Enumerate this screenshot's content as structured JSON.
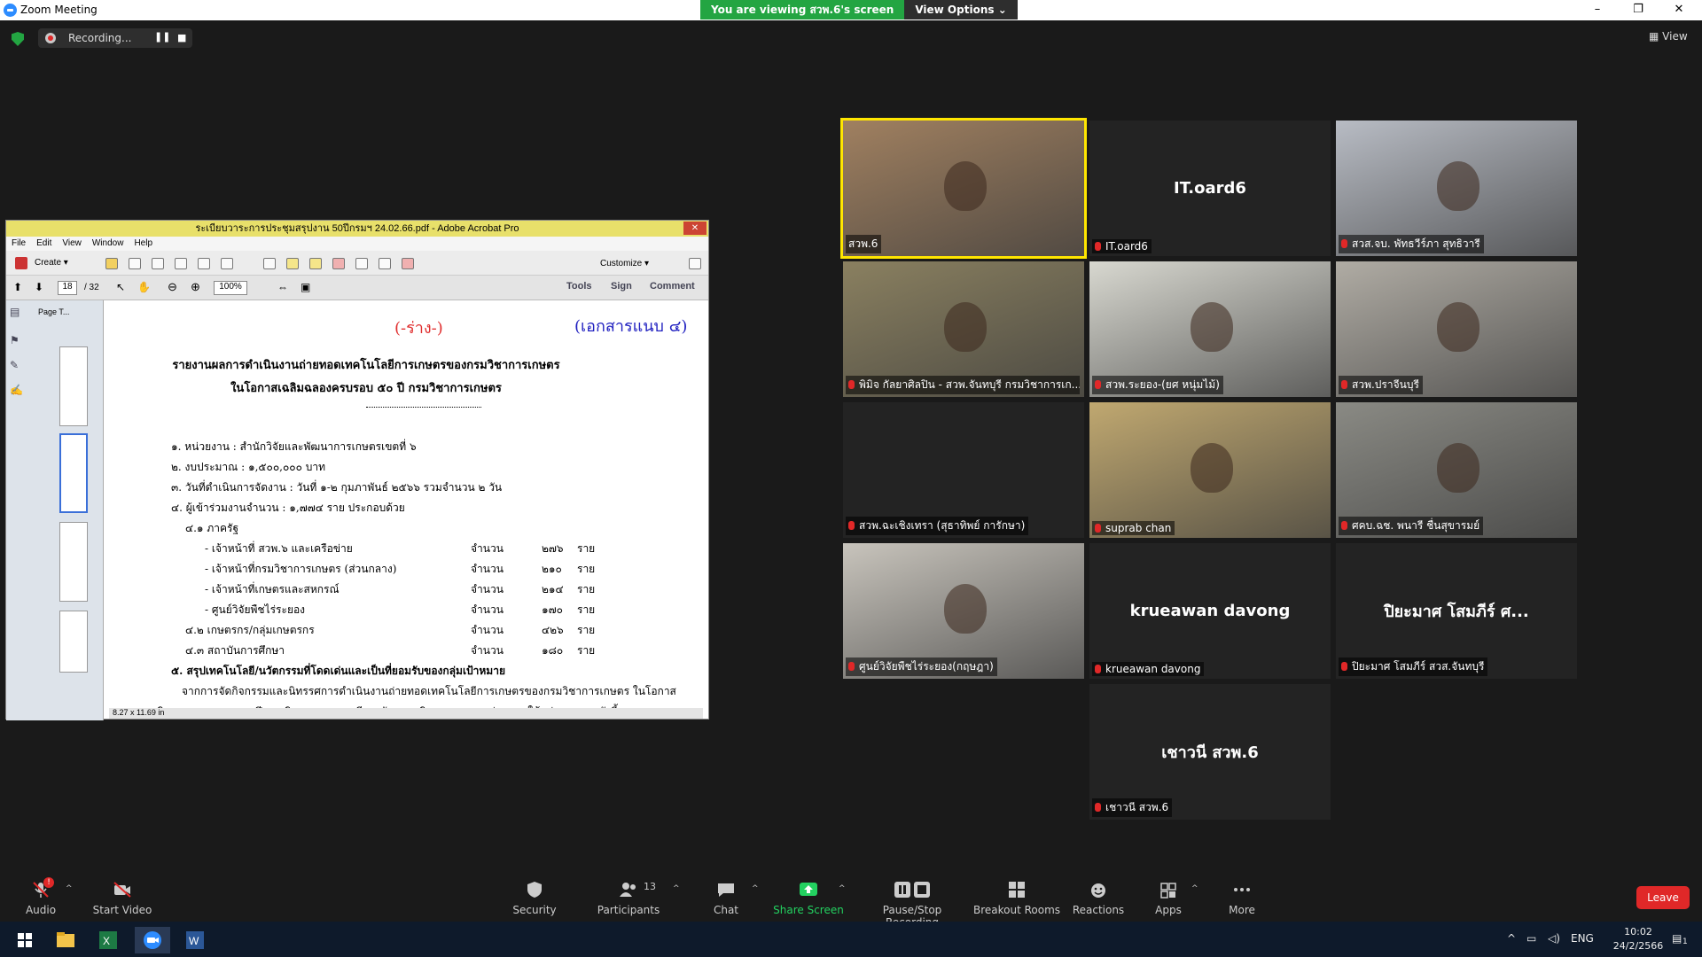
{
  "window": {
    "title": "Zoom Meeting",
    "banner_viewing": "You are viewing สวพ.6's screen",
    "banner_options": "View Options"
  },
  "topbar": {
    "recording_label": "Recording...",
    "view_label": "View"
  },
  "acrobat": {
    "title": "ระเบียบวาระการประชุมสรุปงาน 50ปีกรมฯ 24.02.66.pdf - Adobe Acrobat Pro",
    "menu": [
      "File",
      "Edit",
      "View",
      "Window",
      "Help"
    ],
    "create_label": "Create",
    "customize_label": "Customize",
    "page_current": "18",
    "page_total": "/ 32",
    "zoom": "100%",
    "tab_tools": "Tools",
    "tab_sign": "Sign",
    "tab_comment": "Comment",
    "page_thumbnails_label": "Page T...",
    "page_size": "8.27 x 11.69 in",
    "document": {
      "draft": "(-ร่าง-)",
      "attachment": "(เอกสารแนบ ๔)",
      "heading1": "รายงานผลการดำเนินงานถ่ายทอดเทคโนโลยีการเกษตรของกรมวิชาการเกษตร",
      "heading2": "ในโอกาสเฉลิมฉลองครบรอบ ๕๐ ปี กรมวิชาการเกษตร",
      "lines": [
        "๑. หน่วยงาน : สำนักวิจัยและพัฒนาการเกษตรเขตที่ ๖",
        "๒. งบประมาณ :  ๑,๕๐๐,๐๐๐  บาท",
        "๓. วันที่ดำเนินการจัดงาน : วันที่ ๑-๒ กุมภาพันธ์  ๒๕๖๖ รวมจำนวน ๒ วัน",
        "๔. ผู้เข้าร่วมงานจำนวน : ๑,๗๗๔ ราย ประกอบด้วย",
        "๔.๑ ภาครัฐ"
      ],
      "rows": [
        {
          "label": "- เจ้าหน้าที่ สวพ.๖ และเครือข่าย",
          "unit": "จำนวน",
          "value": "๒๗๖",
          "suffix": "ราย"
        },
        {
          "label": "- เจ้าหน้าที่กรมวิชาการเกษตร (ส่วนกลาง)",
          "unit": "จำนวน",
          "value": "๒๑๐",
          "suffix": "ราย"
        },
        {
          "label": "- เจ้าหน้าที่เกษตรและสหกรณ์",
          "unit": "จำนวน",
          "value": "๒๑๔",
          "suffix": "ราย"
        },
        {
          "label": "- ศูนย์วิจัยพืชไร่ระยอง",
          "unit": "จำนวน",
          "value": "๑๗๐",
          "suffix": "ราย"
        },
        {
          "label": "๔.๒ เกษตรกร/กลุ่มเกษตรกร",
          "unit": "จำนวน",
          "value": "๔๒๖",
          "suffix": "ราย"
        },
        {
          "label": "๔.๓ สถาบันการศึกษา",
          "unit": "จำนวน",
          "value": "๑๘๐",
          "suffix": "ราย"
        }
      ],
      "line5": "๕. สรุปเทคโนโลยี/นวัตกรรมที่โดดเด่นและเป็นที่ยอมรับของกลุ่มเป้าหมาย",
      "para1": "จากการจัดกิจกรรมและนิทรรศการดำเนินงานถ่ายทอดเทคโนโลยีการเกษตรของกรมวิชาการเกษตร ในโอกาส",
      "para2": "เฉลิมฉลองครบรอบ ๕๐ ปี กรมวิชาการเกษตร มีการจัดแสดงนิทรรศการและถ่ายทอดให้แก่เกษตรกร ดังนี้"
    }
  },
  "participants": [
    {
      "name": "สวพ.6",
      "display": "",
      "type": "video",
      "bg": "#a08060",
      "active": true
    },
    {
      "name": "IT.oard6",
      "display": "IT.oard6",
      "type": "name"
    },
    {
      "name": "สวส.จบ. พัทธวีร์ภา สุทธิวารี",
      "display": "",
      "type": "video",
      "bg": "#b8bcc4"
    },
    {
      "name": "พิมิจ กัลยาศิลปิน - สวพ.จันทบุรี กรมวิชาการเก...",
      "display": "",
      "type": "video",
      "bg": "#8a8060"
    },
    {
      "name": "สวพ.ระยอง-(ยศ หนุ่มไม้)",
      "display": "",
      "type": "video",
      "bg": "#d8d8d0"
    },
    {
      "name": "สวพ.ปราจีนบุรี",
      "display": "",
      "type": "video",
      "bg": "#b0aca4"
    },
    {
      "name": "สวพ.ฉะเชิงเทรา (สุธาทิพย์ การักษา)",
      "display": "",
      "type": "blank"
    },
    {
      "name": "suprab chan",
      "display": "",
      "type": "video",
      "bg": "#c0a870"
    },
    {
      "name": "ศคบ.ฉช. พนารี ชื่นสุขารมย์",
      "display": "",
      "type": "video",
      "bg": "#8a8a84"
    },
    {
      "name": "ศูนย์วิจัยพืชไร่ระยอง(กฤษฎา)",
      "display": "",
      "type": "video",
      "bg": "#c8c4bc"
    },
    {
      "name": "krueawan davong",
      "display": "krueawan davong",
      "type": "name"
    },
    {
      "name": "ปิยะมาศ โสมภีร์ สวส.จันทบุรี",
      "display": "ปิยะมาศ โสมภีร์ ศ...",
      "type": "name"
    },
    {
      "name": "เชาวนี สวพ.6",
      "display": "เชาวนี สวพ.6",
      "type": "name"
    }
  ],
  "toolbar": {
    "audio": "Audio",
    "start_video": "Start Video",
    "security": "Security",
    "participants": "Participants",
    "participants_count": "13",
    "chat": "Chat",
    "share_screen": "Share Screen",
    "pause_recording": "Pause/Stop Recording",
    "breakout": "Breakout Rooms",
    "reactions": "Reactions",
    "apps": "Apps",
    "more": "More",
    "leave": "Leave",
    "audio_badge": "!"
  },
  "taskbar": {
    "lang": "ENG",
    "time": "10:02",
    "date": "24/2/2566",
    "notif_count": "1"
  },
  "colors": {
    "accent_green": "#23a542",
    "leave_red": "#e02828",
    "active_speaker": "#ffe600"
  }
}
